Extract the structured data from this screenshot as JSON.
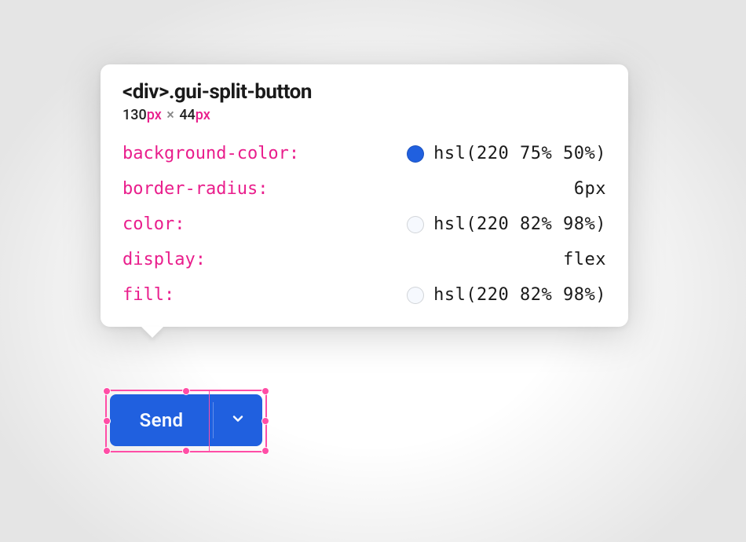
{
  "tooltip": {
    "selector": "<div>.gui-split-button",
    "width_num": "130",
    "width_unit": "px",
    "height_num": "44",
    "height_unit": "px",
    "properties": [
      {
        "name": "background-color",
        "swatch": "hsl(220 75% 50%)",
        "value": "hsl(220 75% 50%)"
      },
      {
        "name": "border-radius",
        "swatch": null,
        "value": "6px"
      },
      {
        "name": "color",
        "swatch": "hsl(220 82% 98%)",
        "value": "hsl(220 82% 98%)"
      },
      {
        "name": "display",
        "swatch": null,
        "value": "flex"
      },
      {
        "name": "fill",
        "swatch": "hsl(220 82% 98%)",
        "value": "hsl(220 82% 98%)"
      }
    ]
  },
  "button": {
    "label": "Send"
  },
  "colors": {
    "accent_pink": "#e91e8c",
    "selection_pink": "#ff4da6",
    "button_bg": "hsl(220 75% 50%)",
    "button_fg": "hsl(220 82% 98%)"
  }
}
